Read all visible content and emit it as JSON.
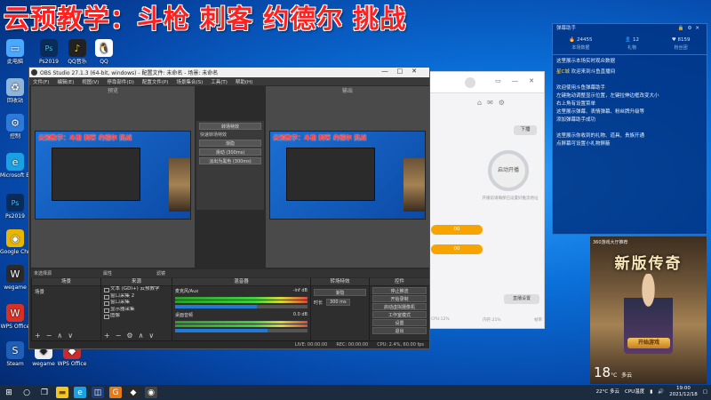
{
  "overlay": {
    "title": "云预教学：斗枪 刺客 约德尔 挑战"
  },
  "desktop_icons": [
    {
      "label": "此电脑",
      "icon": "computer-icon",
      "color": "#4aa8ff",
      "glyph": "▭"
    },
    {
      "label": "回收站",
      "icon": "recycle-bin-icon",
      "color": "#8fb6d8",
      "glyph": "♻"
    },
    {
      "label": "Microsoft Edge",
      "icon": "edge-icon",
      "color": "#1ba0e2",
      "glyph": "e"
    },
    {
      "label": "控制",
      "icon": "control-panel-icon",
      "color": "#2d7bd8",
      "glyph": "⚙"
    },
    {
      "label": "Google Chrome",
      "icon": "chrome-icon",
      "color": "#e7b600",
      "glyph": "◉"
    },
    {
      "label": "wegame",
      "icon": "wegame-icon",
      "color": "#2a2a2a",
      "glyph": "W"
    },
    {
      "label": "WPS Office",
      "icon": "wps-icon",
      "color": "#d93025",
      "glyph": "W"
    },
    {
      "label": "Steam",
      "icon": "steam-icon",
      "color": "#1f5fb8",
      "glyph": "S"
    }
  ],
  "desktop_icons_top": [
    {
      "label": "Ps2019",
      "icon": "photoshop-icon",
      "color": "#0a2c5a",
      "glyph": "Ps"
    },
    {
      "label": "QQ音乐",
      "icon": "qq-music-icon",
      "color": "#f4c400",
      "glyph": "♪"
    }
  ],
  "obs": {
    "title": "OBS Studio 27.1.3 (64-bit, windows) - 配置文件: 未命名 - 场景: 未命名",
    "menu": [
      "文件(F)",
      "编辑(E)",
      "视图(V)",
      "停靠部件(D)",
      "配置文件(P)",
      "场景集合(S)",
      "工具(T)",
      "帮助(H)"
    ],
    "preview_label": "预览",
    "program_label": "输出",
    "mini_title": "云预教学：斗枪 刺客 约德尔 挑战",
    "transition": {
      "label": "转场特效",
      "quick_label": "快速转场特效",
      "items": [
        "渐隐",
        "滑动 (300ms)",
        "淡出为黑色 (300ms)"
      ]
    },
    "source_bar": {
      "none_selected": "未选择源",
      "properties": "属性",
      "filters": "滤镜"
    },
    "docks": {
      "scenes": {
        "header": "场景",
        "items": [
          "场景"
        ]
      },
      "sources": {
        "header": "来源",
        "items": [
          "文本 (GDI+) 云预教学",
          "窗口采集 2",
          "窗口采集",
          "显示器采集",
          "图像"
        ]
      },
      "mixer": {
        "header": "混音器",
        "channels": [
          {
            "name": "麦克风/Aux",
            "db": "-inf dB",
            "level": 0.62
          },
          {
            "name": "桌面音频",
            "db": "0.0 dB",
            "level": 0.7
          }
        ]
      },
      "transitions": {
        "header": "转场特效",
        "value": "渐隐",
        "duration_label": "时长",
        "duration": "300 ms"
      },
      "controls": {
        "header": "控件",
        "buttons": [
          "停止推流",
          "开始录制",
          "启动虚拟摄像机",
          "工作室模式",
          "设置",
          "退出"
        ]
      }
    },
    "status": [
      "LIVE: 00:00:00",
      "REC: 00:00:00",
      "CPU: 2.4%, 60.00 fps"
    ]
  },
  "helper_app": {
    "end_live_label": "下播",
    "start_live_label": "启动开播",
    "hint": "开播前请确保已设置好推流地址",
    "fields": [
      "00",
      "00"
    ],
    "settings_btn": "直播设置",
    "footer": [
      "CPU:12%",
      "内存:21%",
      "帧率"
    ]
  },
  "chat_panel": {
    "title": "弹幕助手",
    "stats": [
      {
        "icon": "fire-icon",
        "value": "24455"
      },
      {
        "icon": "user-icon",
        "value": "12"
      },
      {
        "icon": "heart-icon",
        "value": "8159"
      }
    ],
    "tabs": [
      "本场数据",
      "礼物",
      "粉丝团"
    ],
    "messages": [
      {
        "name": "",
        "text": "这里展示本场实时观众数据"
      },
      {
        "name": "星C城",
        "text": "欢迎来到斗鱼直播间"
      },
      {
        "name": "",
        "text": "欢迎使用斗鱼弹幕助手"
      },
      {
        "name": "",
        "text": "左键拖动调整显示位置，左键拉伸边框改变大小"
      },
      {
        "name": "",
        "text": "右上角有设置菜单"
      },
      {
        "name": "",
        "text": "这里展示弹幕、表情弹幕、粉丝牌升级等"
      },
      {
        "name": "",
        "text": "添加弹幕助手成功"
      },
      {
        "name": "",
        "text": "这里展示你收到的礼物、道具、贵族开通"
      },
      {
        "name": "",
        "text": "点屏幕可设置小礼物屏蔽"
      }
    ]
  },
  "ad": {
    "header": "360游戏大厅推荐",
    "title": "新版传奇",
    "start_button": "开始游戏",
    "temp": "18",
    "temp_unit": "°C",
    "weather": "多云"
  },
  "taskbar": {
    "weather": "22°C 多云",
    "time": "19:00",
    "date": "2021/12/18",
    "cpu": "CPU温度"
  }
}
